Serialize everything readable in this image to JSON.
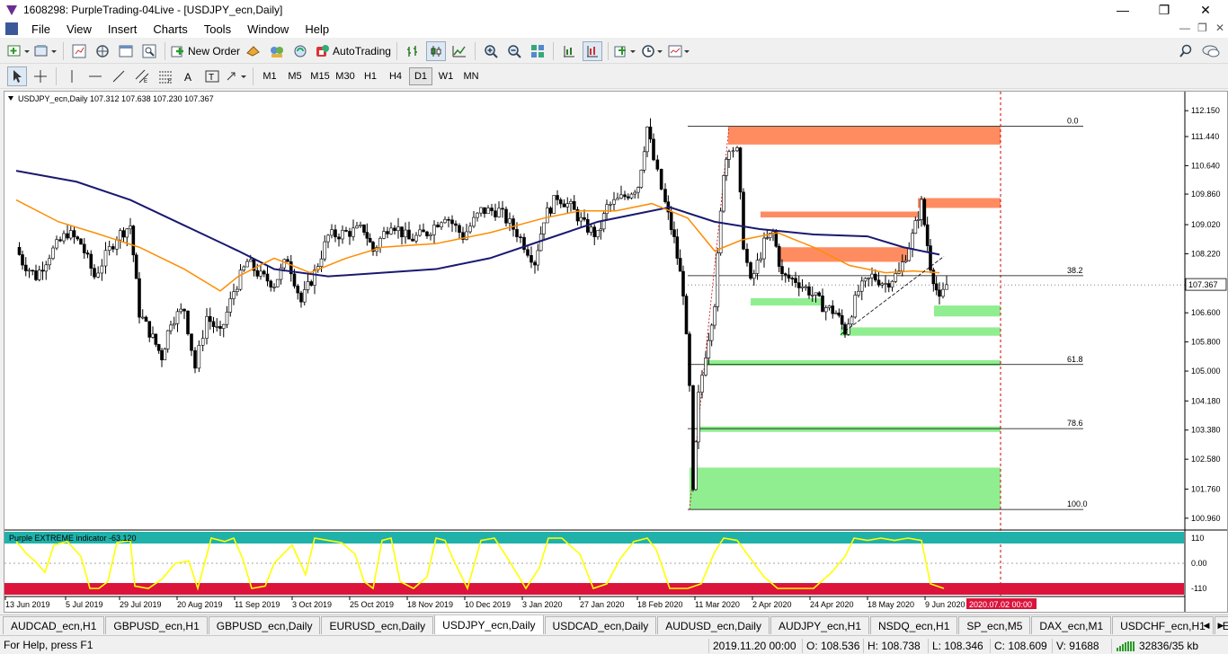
{
  "window": {
    "title": "1608298: PurpleTrading-04Live - [USDJPY_ecn,Daily]",
    "minimize": "—",
    "maximize": "❐",
    "close": "✕"
  },
  "menu": {
    "items": [
      "File",
      "View",
      "Insert",
      "Charts",
      "Tools",
      "Window",
      "Help"
    ],
    "doc_minimize": "—",
    "doc_restore": "❐",
    "doc_close": "✕"
  },
  "toolbar": {
    "new_order_label": "New Order",
    "autotrading_label": "AutoTrading",
    "timeframes": [
      "M1",
      "M5",
      "M15",
      "M30",
      "H1",
      "H4",
      "D1",
      "W1",
      "MN"
    ],
    "active_timeframe": "D1"
  },
  "chart_header": {
    "symbol": "USDJPY_ecn,Daily",
    "ohlc": "107.312 107.638 107.230 107.367"
  },
  "indicator": {
    "label": "Purple EXTREME indicator -63.120",
    "levels": [
      "110",
      "0.00",
      "-110"
    ]
  },
  "chart_data": {
    "type": "candlestick",
    "symbol": "USDJPY_ecn",
    "timeframe": "Daily",
    "last_price": "107.367",
    "ylim": [
      100.66,
      112.55
    ],
    "price_ticks": [
      "112.150",
      "111.440",
      "110.640",
      "109.860",
      "109.020",
      "108.220",
      "107.367",
      "106.600",
      "105.800",
      "105.000",
      "104.180",
      "103.380",
      "102.580",
      "101.760",
      "100.960"
    ],
    "date_ticks": [
      "13 Jun 2019",
      "5 Jul 2019",
      "29 Jul 2019",
      "20 Aug 2019",
      "11 Sep 2019",
      "3 Oct 2019",
      "25 Oct 2019",
      "18 Nov 2019",
      "10 Dec 2019",
      "3 Jan 2020",
      "27 Jan 2020",
      "18 Feb 2020",
      "11 Mar 2020",
      "2 Apr 2020",
      "24 Apr 2020",
      "18 May 2020",
      "9 Jun 2020"
    ],
    "future_date_label": "2020.07.02 00:00",
    "fibonacci": [
      {
        "level": "0.0",
        "price": 111.72
      },
      {
        "level": "38.2",
        "price": 107.62
      },
      {
        "level": "61.8",
        "price": 105.18
      },
      {
        "level": "78.6",
        "price": 103.42
      },
      {
        "level": "100.0",
        "price": 101.2
      }
    ],
    "supply_zones": [
      {
        "from": 111.72,
        "to": 111.22
      },
      {
        "from": 109.75,
        "to": 109.48
      },
      {
        "from": 109.38,
        "to": 109.22
      },
      {
        "from": 108.4,
        "to": 108.0
      }
    ],
    "demand_zones": [
      {
        "from": 107.0,
        "to": 106.8
      },
      {
        "from": 106.8,
        "to": 106.5
      },
      {
        "from": 106.2,
        "to": 105.97
      },
      {
        "from": 105.3,
        "to": 105.15
      },
      {
        "from": 103.48,
        "to": 103.33
      },
      {
        "from": 102.35,
        "to": 101.2
      }
    ],
    "ma_slow_points": [
      [
        13,
        110.5
      ],
      [
        80,
        110.2
      ],
      [
        140,
        109.7
      ],
      [
        200,
        109.0
      ],
      [
        260,
        108.3
      ],
      [
        300,
        107.8
      ],
      [
        360,
        107.6
      ],
      [
        420,
        107.7
      ],
      [
        480,
        107.8
      ],
      [
        540,
        108.1
      ],
      [
        600,
        108.6
      ],
      [
        660,
        109.1
      ],
      [
        700,
        109.3
      ],
      [
        740,
        109.5
      ],
      [
        790,
        109.1
      ],
      [
        840,
        108.9
      ],
      [
        900,
        108.75
      ],
      [
        960,
        108.7
      ],
      [
        1000,
        108.4
      ],
      [
        1040,
        108.2
      ]
    ],
    "ma_fast_points": [
      [
        13,
        109.7
      ],
      [
        60,
        109.1
      ],
      [
        100,
        108.8
      ],
      [
        150,
        108.4
      ],
      [
        200,
        107.8
      ],
      [
        240,
        107.2
      ],
      [
        260,
        107.6
      ],
      [
        300,
        108.1
      ],
      [
        340,
        107.7
      ],
      [
        380,
        108.1
      ],
      [
        420,
        108.4
      ],
      [
        480,
        108.5
      ],
      [
        540,
        108.8
      ],
      [
        600,
        109.2
      ],
      [
        640,
        109.4
      ],
      [
        680,
        109.4
      ],
      [
        720,
        109.6
      ],
      [
        760,
        109.2
      ],
      [
        790,
        108.3
      ],
      [
        820,
        108.6
      ],
      [
        860,
        108.8
      ],
      [
        900,
        108.4
      ],
      [
        940,
        107.9
      ],
      [
        980,
        107.7
      ],
      [
        1010,
        107.75
      ],
      [
        1040,
        107.7
      ]
    ],
    "close_path": [
      [
        13,
        108.4
      ],
      [
        20,
        108.0
      ],
      [
        35,
        107.6
      ],
      [
        50,
        108.2
      ],
      [
        70,
        108.8
      ],
      [
        85,
        108.5
      ],
      [
        100,
        107.6
      ],
      [
        125,
        108.7
      ],
      [
        140,
        109.0
      ],
      [
        150,
        106.6
      ],
      [
        165,
        105.9
      ],
      [
        175,
        105.4
      ],
      [
        185,
        106.4
      ],
      [
        200,
        106.7
      ],
      [
        212,
        105.1
      ],
      [
        225,
        106.5
      ],
      [
        240,
        106.0
      ],
      [
        255,
        107.2
      ],
      [
        270,
        108.0
      ],
      [
        285,
        107.6
      ],
      [
        300,
        107.4
      ],
      [
        315,
        108.1
      ],
      [
        330,
        106.9
      ],
      [
        345,
        107.7
      ],
      [
        360,
        108.7
      ],
      [
        380,
        108.8
      ],
      [
        400,
        108.9
      ],
      [
        410,
        108.3
      ],
      [
        430,
        109.1
      ],
      [
        450,
        108.6
      ],
      [
        470,
        108.8
      ],
      [
        490,
        109.3
      ],
      [
        510,
        108.7
      ],
      [
        530,
        109.4
      ],
      [
        550,
        109.4
      ],
      [
        570,
        108.8
      ],
      [
        590,
        108.0
      ],
      [
        600,
        109.2
      ],
      [
        615,
        109.8
      ],
      [
        630,
        109.5
      ],
      [
        645,
        109.0
      ],
      [
        660,
        108.7
      ],
      [
        670,
        109.5
      ],
      [
        690,
        109.8
      ],
      [
        705,
        110.1
      ],
      [
        715,
        111.7
      ],
      [
        722,
        110.8
      ],
      [
        735,
        109.6
      ],
      [
        745,
        108.6
      ],
      [
        755,
        107.2
      ],
      [
        762,
        104.5
      ],
      [
        766,
        101.6
      ],
      [
        772,
        104.3
      ],
      [
        780,
        105.5
      ],
      [
        790,
        106.9
      ],
      [
        800,
        110.5
      ],
      [
        806,
        111.2
      ],
      [
        815,
        111.0
      ],
      [
        822,
        108.5
      ],
      [
        830,
        107.4
      ],
      [
        845,
        108.5
      ],
      [
        855,
        108.8
      ],
      [
        865,
        107.6
      ],
      [
        880,
        107.5
      ],
      [
        895,
        107.2
      ],
      [
        910,
        106.8
      ],
      [
        925,
        106.6
      ],
      [
        935,
        106.1
      ],
      [
        950,
        107.2
      ],
      [
        965,
        107.6
      ],
      [
        980,
        107.4
      ],
      [
        995,
        107.7
      ],
      [
        1010,
        108.7
      ],
      [
        1020,
        109.6
      ],
      [
        1030,
        107.9
      ],
      [
        1040,
        106.9
      ],
      [
        1048,
        107.37
      ]
    ],
    "oscillator_path": [
      [
        13,
        95
      ],
      [
        25,
        40
      ],
      [
        35,
        5
      ],
      [
        45,
        -40
      ],
      [
        55,
        80
      ],
      [
        70,
        95
      ],
      [
        85,
        30
      ],
      [
        95,
        -110
      ],
      [
        105,
        -110
      ],
      [
        115,
        -80
      ],
      [
        125,
        90
      ],
      [
        140,
        100
      ],
      [
        145,
        -100
      ],
      [
        160,
        -110
      ],
      [
        175,
        -70
      ],
      [
        190,
        0
      ],
      [
        205,
        10
      ],
      [
        215,
        -110
      ],
      [
        230,
        110
      ],
      [
        245,
        95
      ],
      [
        255,
        110
      ],
      [
        265,
        20
      ],
      [
        275,
        -110
      ],
      [
        290,
        -100
      ],
      [
        300,
        0
      ],
      [
        320,
        80
      ],
      [
        335,
        -50
      ],
      [
        345,
        110
      ],
      [
        360,
        100
      ],
      [
        375,
        90
      ],
      [
        390,
        40
      ],
      [
        400,
        -80
      ],
      [
        410,
        -110
      ],
      [
        420,
        100
      ],
      [
        430,
        110
      ],
      [
        440,
        -80
      ],
      [
        455,
        -110
      ],
      [
        470,
        -60
      ],
      [
        480,
        110
      ],
      [
        490,
        100
      ],
      [
        500,
        10
      ],
      [
        515,
        -110
      ],
      [
        530,
        100
      ],
      [
        545,
        110
      ],
      [
        560,
        20
      ],
      [
        580,
        -110
      ],
      [
        595,
        -20
      ],
      [
        605,
        110
      ],
      [
        620,
        110
      ],
      [
        640,
        40
      ],
      [
        655,
        -110
      ],
      [
        670,
        -90
      ],
      [
        685,
        20
      ],
      [
        700,
        95
      ],
      [
        715,
        110
      ],
      [
        725,
        60
      ],
      [
        740,
        -110
      ],
      [
        760,
        -110
      ],
      [
        775,
        -90
      ],
      [
        790,
        50
      ],
      [
        800,
        110
      ],
      [
        815,
        100
      ],
      [
        830,
        20
      ],
      [
        845,
        -60
      ],
      [
        860,
        -110
      ],
      [
        880,
        -110
      ],
      [
        900,
        -110
      ],
      [
        920,
        -40
      ],
      [
        935,
        30
      ],
      [
        945,
        110
      ],
      [
        960,
        100
      ],
      [
        975,
        110
      ],
      [
        990,
        100
      ],
      [
        1005,
        110
      ],
      [
        1020,
        100
      ],
      [
        1030,
        -90
      ],
      [
        1045,
        -110
      ]
    ]
  },
  "tabs": [
    "AUDCAD_ecn,H1",
    "GBPUSD_ecn,H1",
    "GBPUSD_ecn,Daily",
    "EURUSD_ecn,Daily",
    "USDJPY_ecn,Daily",
    "USDCAD_ecn,Daily",
    "AUDUSD_ecn,Daily",
    "AUDJPY_ecn,H1",
    "NSDQ_ecn,H1",
    "SP_ecn,M5",
    "DAX_ecn,M1",
    "USDCHF_ecn,H1",
    "EURI"
  ],
  "active_tab": "USDJPY_ecn,Daily",
  "status": {
    "help": "For Help, press F1",
    "datetime": "2019.11.20 00:00",
    "open": "O: 108.536",
    "high": "H: 108.738",
    "low": "L: 108.346",
    "close": "C: 108.609",
    "volume": "V: 91688",
    "traffic": "32836/35 kb"
  }
}
